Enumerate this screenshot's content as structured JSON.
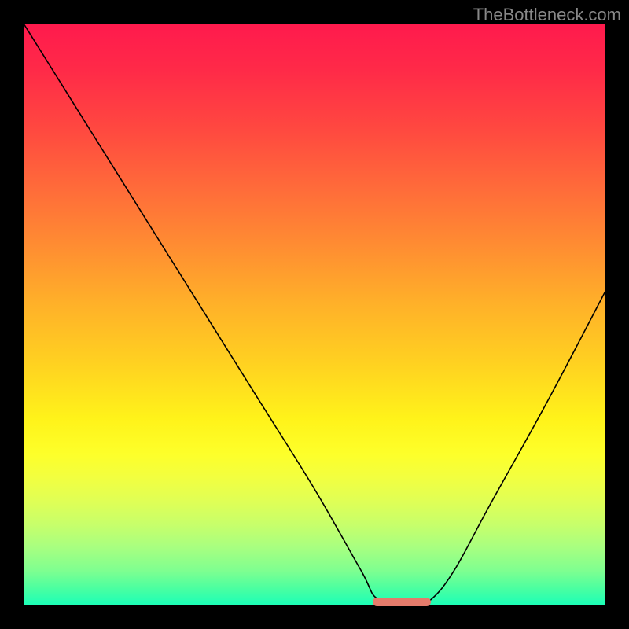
{
  "watermark": "TheBottleneck.com",
  "chart_data": {
    "type": "line",
    "title": "",
    "xlabel": "",
    "ylabel": "",
    "xlim": [
      0,
      100
    ],
    "ylim": [
      0,
      100
    ],
    "grid": false,
    "legend": false,
    "series": [
      {
        "name": "bottleneck-curve",
        "x": [
          0,
          10,
          20,
          30,
          40,
          50,
          58,
          61,
          67,
          70,
          74,
          80,
          90,
          100
        ],
        "y": [
          100,
          84,
          68,
          52,
          36,
          20,
          6,
          1,
          0,
          1,
          6,
          17,
          35,
          54
        ]
      }
    ],
    "annotations": [
      {
        "name": "optimal-range",
        "x_start": 60,
        "x_end": 70,
        "y": 0.5,
        "color": "#e47b6b"
      }
    ],
    "gradient_colors": {
      "top": "#ff1a4d",
      "mid_upper": "#ff8c32",
      "mid": "#fff31a",
      "mid_lower": "#c8ff6a",
      "bottom": "#1affb8"
    }
  }
}
